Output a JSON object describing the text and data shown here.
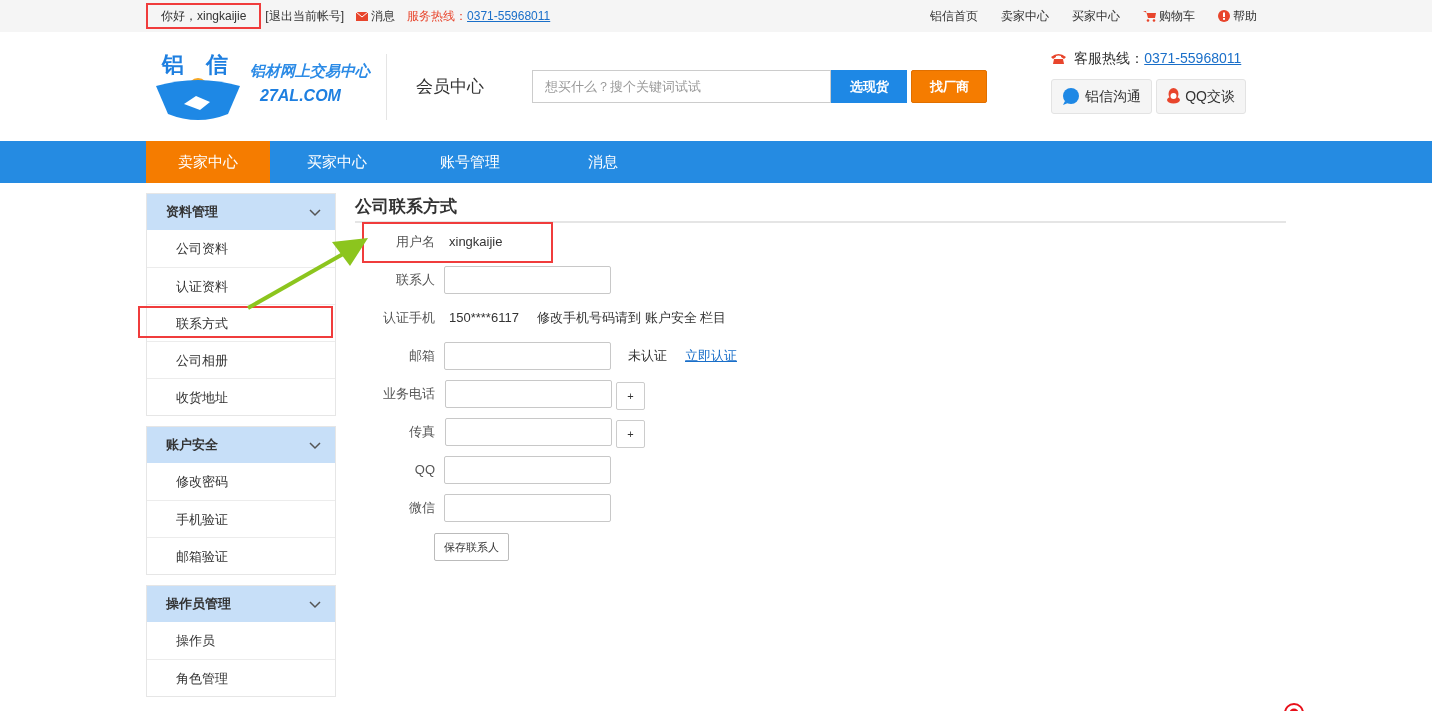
{
  "topbar": {
    "greeting": "你好，xingkaijie",
    "logout": "[退出当前帐号]",
    "messages": "消息",
    "hotline_label": "服务热线：",
    "hotline_number": "0371-55968011",
    "links": [
      {
        "label": "铝信首页",
        "kind": "plain"
      },
      {
        "label": "卖家中心",
        "kind": "plain"
      },
      {
        "label": "买家中心",
        "kind": "plain"
      },
      {
        "label": "购物车",
        "kind": "cart"
      },
      {
        "label": "帮助",
        "kind": "help"
      }
    ]
  },
  "header": {
    "logo_chars": [
      "铝",
      "信"
    ],
    "logo_tagline": "铝材网上交易中心",
    "logo_domain": "27AL.COM",
    "section_title": "会员中心",
    "search": {
      "placeholder": "想买什么？搜个关键词试试"
    },
    "search_buttons": [
      {
        "label": "选现货",
        "kind": "primary"
      },
      {
        "label": "找厂商",
        "kind": "accent"
      }
    ],
    "service_label": "客服热线：",
    "service_number": "0371-55968011",
    "chat_buttons": [
      {
        "label": "铝信沟通",
        "kind": "al"
      },
      {
        "label": "QQ交谈",
        "kind": "qq"
      }
    ]
  },
  "nav": [
    {
      "label": "卖家中心",
      "selected": true
    },
    {
      "label": "买家中心",
      "selected": false
    },
    {
      "label": "账号管理",
      "selected": false
    },
    {
      "label": "消息",
      "selected": false
    }
  ],
  "sidebar": [
    {
      "title": "资料管理",
      "expanded": true,
      "items": [
        "公司资料",
        "认证资料",
        "联系方式",
        "公司相册",
        "收货地址"
      ]
    },
    {
      "title": "账户安全",
      "expanded": true,
      "items": [
        "修改密码",
        "手机验证",
        "邮箱验证"
      ]
    },
    {
      "title": "操作员管理",
      "expanded": true,
      "items": [
        "操作员",
        "角色管理"
      ]
    }
  ],
  "form": {
    "title": "公司联系方式",
    "rows": [
      {
        "kind": "text",
        "label": "用户名",
        "value": "xingkaijie"
      },
      {
        "kind": "input",
        "label": "联系人"
      },
      {
        "kind": "phone",
        "label": "认证手机",
        "value": "150****6117",
        "note": "修改手机号码请到 账户安全 栏目"
      },
      {
        "kind": "verify",
        "label": "邮箱",
        "status": "未认证",
        "link": "立即认证"
      },
      {
        "kind": "add",
        "label": "业务电话",
        "button": "+"
      },
      {
        "kind": "add",
        "label": "传真",
        "button": "+"
      },
      {
        "kind": "input",
        "label": "QQ"
      },
      {
        "kind": "input",
        "label": "微信"
      }
    ],
    "submit": "保存联系人"
  }
}
